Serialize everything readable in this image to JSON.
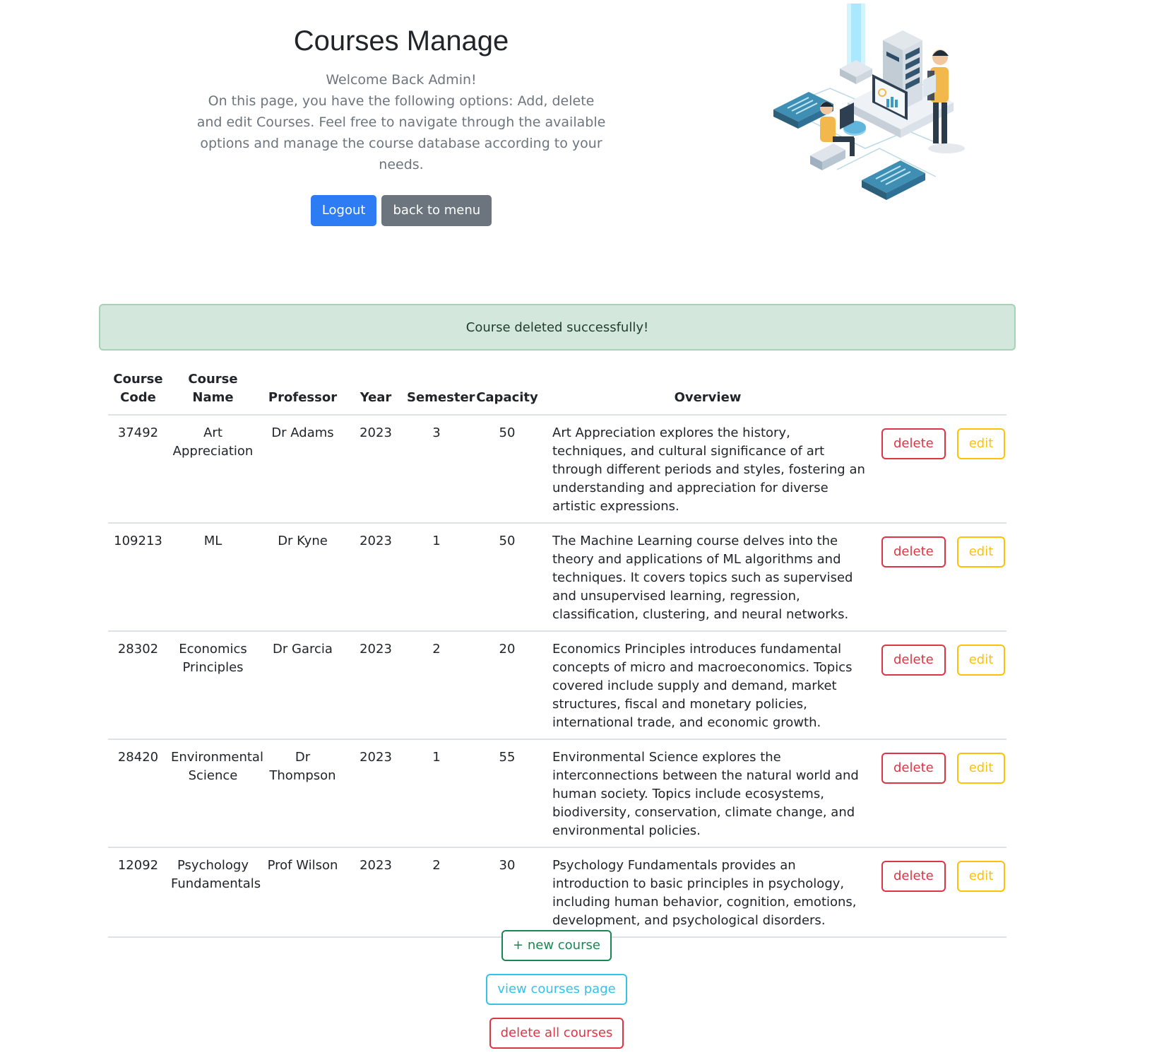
{
  "header": {
    "title": "Courses Manage",
    "welcome": "Welcome Back Admin!",
    "intro": "On this page, you have the following options: Add, delete and edit Courses. Feel free to navigate through the available options and manage the course database according to your needs.",
    "logout_label": "Logout",
    "back_label": "back to menu"
  },
  "alert": {
    "message": "Course deleted successfully!"
  },
  "table": {
    "headers": [
      "Course Code",
      "Course Name",
      "Professor",
      "Year",
      "Semester",
      "Capacity",
      "Overview"
    ],
    "rows": [
      {
        "code": "37492",
        "name": "Art Appreciation",
        "professor": "Dr Adams",
        "year": "2023",
        "semester": "3",
        "capacity": "50",
        "overview": "Art Appreciation explores the history, techniques, and cultural significance of art through different periods and styles, fostering an understanding and appreciation for diverse artistic expressions.",
        "delete_label": "delete",
        "edit_label": "edit"
      },
      {
        "code": "109213",
        "name": "ML",
        "professor": "Dr Kyne",
        "year": "2023",
        "semester": "1",
        "capacity": "50",
        "overview": "The Machine Learning course delves into the theory and applications of ML algorithms and techniques. It covers topics such as supervised and unsupervised learning, regression, classification, clustering, and neural networks.",
        "delete_label": "delete",
        "edit_label": "edit"
      },
      {
        "code": "28302",
        "name": "Economics Principles",
        "professor": "Dr Garcia",
        "year": "2023",
        "semester": "2",
        "capacity": "20",
        "overview": "Economics Principles introduces fundamental concepts of micro and macroeconomics. Topics covered include supply and demand, market structures, fiscal and monetary policies, international trade, and economic growth.",
        "delete_label": "delete",
        "edit_label": "edit"
      },
      {
        "code": "28420",
        "name": "Environmental Science",
        "professor": "Dr Thompson",
        "year": "2023",
        "semester": "1",
        "capacity": "55",
        "overview": "Environmental Science explores the interconnections between the natural world and human society. Topics include ecosystems, biodiversity, conservation, climate change, and environmental policies.",
        "delete_label": "delete",
        "edit_label": "edit"
      },
      {
        "code": "12092",
        "name": "Psychology Fundamentals",
        "professor": "Prof Wilson",
        "year": "2023",
        "semester": "2",
        "capacity": "30",
        "overview": "Psychology Fundamentals provides an introduction to basic principles in psychology, including human behavior, cognition, emotions, development, and psychological disorders.",
        "delete_label": "delete",
        "edit_label": "edit"
      }
    ]
  },
  "bottom": {
    "new_course": "+ new course",
    "view_courses": "view courses page",
    "delete_all": "delete all courses"
  },
  "icons": {
    "illustration": "server-admin-illustration"
  },
  "colors": {
    "primary": "#2d7cf4",
    "secondary": "#6c757d",
    "danger": "#dc3545",
    "warning": "#ffc107",
    "success": "#198754",
    "info": "#35c2e8",
    "alert_bg": "#d4e7dc"
  }
}
